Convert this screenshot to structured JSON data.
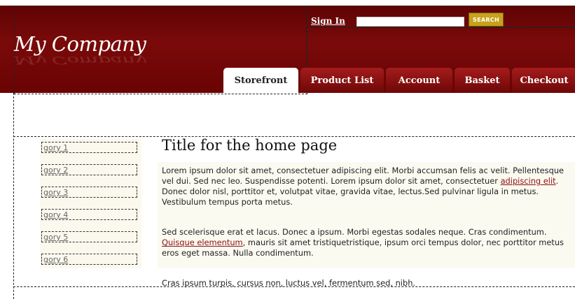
{
  "header": {
    "logo": "My Company",
    "signin_label": "Sign In",
    "search_value": "",
    "search_button_label": "SEARCH"
  },
  "tabs": [
    {
      "label": "Storefront",
      "active": true
    },
    {
      "label": "Product List",
      "active": false
    },
    {
      "label": "Account",
      "active": false
    },
    {
      "label": "Basket",
      "active": false
    },
    {
      "label": "Checkout",
      "active": false
    }
  ],
  "sidebar": {
    "items": [
      "gory 1",
      "gory 2",
      "gory 3",
      "gory 4",
      "gory 5",
      "gory 6"
    ]
  },
  "main": {
    "title": "Title for the home page",
    "p1_a": "Lorem ipsum dolor sit amet, consectetuer adipiscing elit. Morbi accumsan felis ac velit. Pellentesque vel dui. Sed nec leo. Suspendisse potenti. Lorem ipsum dolor sit amet, consectetuer ",
    "p1_link": "adipiscing elit",
    "p1_b": ". Donec dolor nisl, porttitor et, volutpat vitae, gravida vitae, lectus.Sed pulvinar ligula in metus. Vestibulum tempus porta metus.",
    "p2_a": "Sed scelerisque erat et lacus. Donec a ipsum. Morbi egestas sodales neque. Cras condimentum. ",
    "p2_link": "Quisque elementum",
    "p2_b": ", mauris sit amet tristiquetristique, ipsum orci tempus dolor, nec porttitor metus eros eget massa. Nulla condimentum.",
    "p3": "Cras ipsum turpis, cursus non, luctus vel, fermentum sed, nibh."
  },
  "colors": {
    "header_dark": "#5a0202",
    "header_mid": "#7a0a0a",
    "tab_gradient_top": "#a41c1c",
    "search_button": "#c7a21c",
    "link": "#8b1010",
    "content_bg": "#fbfaf1"
  }
}
